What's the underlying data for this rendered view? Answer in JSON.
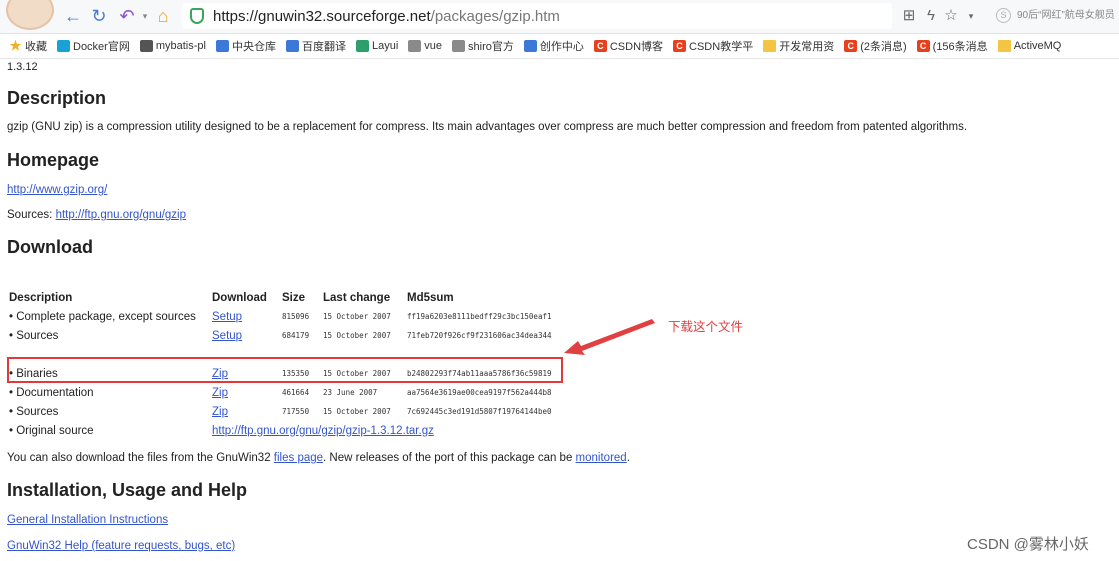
{
  "browser": {
    "url_scheme": "https://",
    "url_host": "gnuwin32.sourceforge.net",
    "url_path": "/packages/gzip.htm",
    "search_suggestion": "90后“网红”航母女舰员"
  },
  "bookmarks": [
    {
      "label": "收藏",
      "icon": "star-icon"
    },
    {
      "label": "Docker官网",
      "icon": "docker-icon"
    },
    {
      "label": "mybatis-pl",
      "icon": "bird-icon"
    },
    {
      "label": "中央仓库",
      "icon": "maven-icon"
    },
    {
      "label": "百度翻译",
      "icon": "translate-icon"
    },
    {
      "label": "Layui",
      "icon": "layui-icon"
    },
    {
      "label": "vue",
      "icon": "doc-icon"
    },
    {
      "label": "shiro官方",
      "icon": "shiro-icon"
    },
    {
      "label": "创作中心",
      "icon": "monitor-icon"
    },
    {
      "label": "CSDN博客",
      "icon": "csdn-icon"
    },
    {
      "label": "CSDN教学平",
      "icon": "csdn-icon"
    },
    {
      "label": "开发常用资",
      "icon": "folder-icon"
    },
    {
      "label": "(2条消息)",
      "icon": "csdn-icon"
    },
    {
      "label": "(156条消息",
      "icon": "csdn-icon"
    },
    {
      "label": "ActiveMQ",
      "icon": "folder-icon"
    }
  ],
  "page": {
    "version": "1.3.12",
    "description_heading": "Description",
    "description_text": "gzip (GNU zip) is a compression utility designed to be a replacement for compress. Its main advantages over compress are much better compression and freedom from patented algorithms.",
    "homepage_heading": "Homepage",
    "homepage_link": "http://www.gzip.org/",
    "sources_label": "Sources: ",
    "sources_link": "http://ftp.gnu.org/gnu/gzip",
    "download_heading": "Download",
    "table_headers": [
      "Description",
      "Download",
      "Size",
      "Last change",
      "Md5sum"
    ],
    "rows": [
      {
        "description": "• Complete package, except sources",
        "download": "Setup",
        "size": "815096",
        "date": "15 October 2007",
        "md5": "ff19a6203e8111bedff29c3bc150eaf1"
      },
      {
        "description": "• Sources",
        "download": "Setup",
        "size": "684179",
        "date": "15 October 2007",
        "md5": "71feb720f926cf9f231606ac34dea344"
      },
      {
        "description": "• Binaries",
        "download": "Zip",
        "size": "135350",
        "date": "15 October 2007",
        "md5": "b24802293f74ab11aaa5786f36c59819"
      },
      {
        "description": "• Documentation",
        "download": "Zip",
        "size": "461664",
        "date": "23 June 2007",
        "md5": "aa7564e3619ae00cea9197f562a444b8"
      },
      {
        "description": "• Sources",
        "download": "Zip",
        "size": "717550",
        "date": "15 October 2007",
        "md5": "7c692445c3ed191d5807f19764144be0"
      }
    ],
    "original_source_label": "• Original source",
    "original_source_link": "http://ftp.gnu.org/gnu/gzip/gzip-1.3.12.tar.gz",
    "also_download_prefix": "You can also download the files from the GnuWin32 ",
    "files_page_link": "files page",
    "also_download_middle": ". New releases of the port of this package can be ",
    "monitored_link": "monitored",
    "also_download_suffix": ".",
    "install_heading": "Installation, Usage and Help",
    "install_link": "General Installation Instructions",
    "help_link": "GnuWin32 Help (feature requests, bugs, etc)"
  },
  "annotation": {
    "text": "下载这个文件",
    "color": "#e04040"
  },
  "watermark": "CSDN @雾林小妖"
}
